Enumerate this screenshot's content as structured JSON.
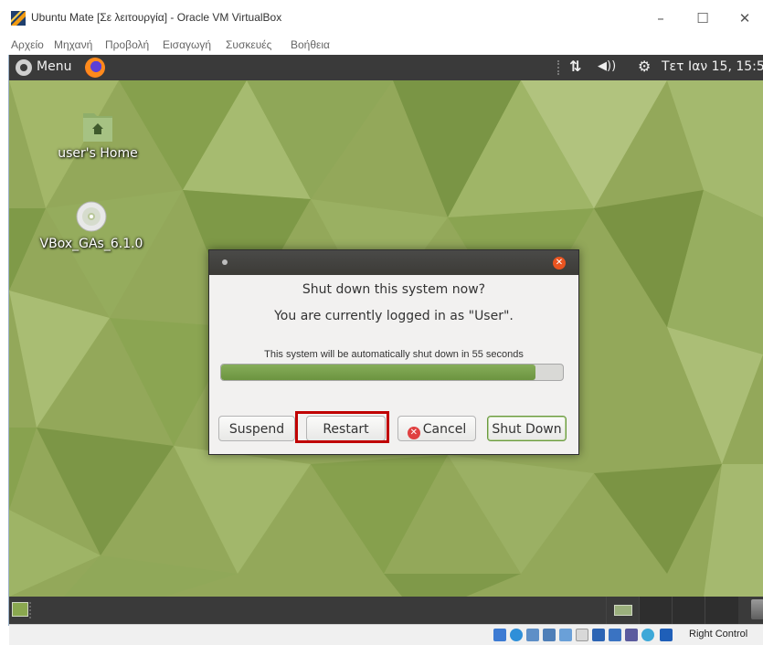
{
  "window": {
    "title": "Ubuntu Mate [Σε λειτουργία] - Oracle VM VirtualBox",
    "minimize": "–",
    "maximize": "☐",
    "close": "✕"
  },
  "vbox_menu": [
    "Αρχείο",
    "Μηχανή",
    "Προβολή",
    "Εισαγωγή",
    "Συσκευές",
    "Βοήθεια"
  ],
  "top_panel": {
    "menu_label": "Menu",
    "clock": "Τετ Ιαν 15, 15:5"
  },
  "desktop_icons": [
    {
      "label": "user's Home",
      "icon": "home-folder-icon"
    },
    {
      "label": "VBox_GAs_6.1.0",
      "icon": "cd-disc-icon"
    }
  ],
  "dialog": {
    "heading": "Shut down this system now?",
    "subheading": "You are currently logged in as \"User\".",
    "countdown": "This system will be automatically shut down in 55 seconds",
    "progress": 0.92,
    "buttons": {
      "suspend": "Suspend",
      "restart": "Restart",
      "cancel": "Cancel",
      "shutdown": "Shut Down"
    }
  },
  "statusbar": {
    "host_key": "Right Control"
  },
  "colors": {
    "panel": "#3a3a3a",
    "wallpaper": "#93a85a",
    "accent_orange": "#e95420",
    "progress_green": "#7aa14c",
    "highlight_red": "#c00000"
  }
}
